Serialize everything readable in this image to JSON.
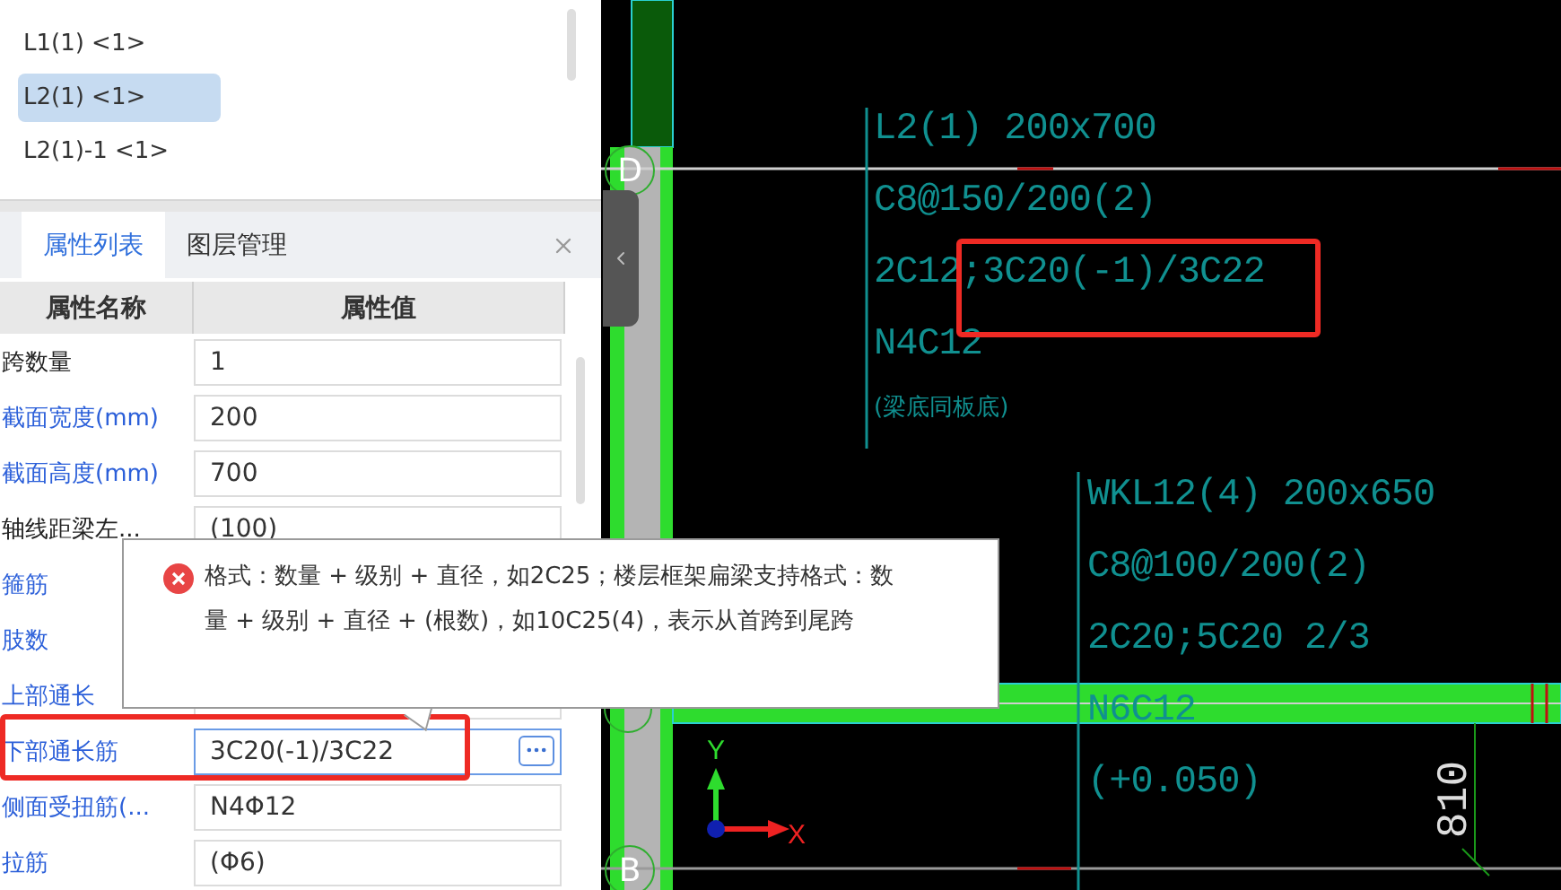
{
  "tree": {
    "items": [
      {
        "label": "L1(1) <1>",
        "selected": false
      },
      {
        "label": "L2(1) <1>",
        "selected": true
      },
      {
        "label": "L2(1)-1 <1>",
        "selected": false
      }
    ]
  },
  "tabs": [
    {
      "label": "属性列表",
      "selected": true
    },
    {
      "label": "图层管理",
      "selected": false
    }
  ],
  "table": {
    "columns": [
      "属性名称",
      "属性值"
    ],
    "rows": [
      {
        "name": "跨数量",
        "kind": "private",
        "value": "1",
        "focused": false
      },
      {
        "name": "截面宽度(mm)",
        "kind": "common",
        "value": "200",
        "focused": false
      },
      {
        "name": "截面高度(mm)",
        "kind": "common",
        "value": "700",
        "focused": false
      },
      {
        "name": "轴线距梁左...",
        "kind": "private",
        "value": "(100)",
        "focused": false
      },
      {
        "name": "箍筋",
        "kind": "common"
      },
      {
        "name": "肢数",
        "kind": "common"
      },
      {
        "name": "上部通长",
        "kind": "common"
      },
      {
        "name": "下部通长筋",
        "kind": "common",
        "value": "3C20(-1)/3C22",
        "focused": true
      },
      {
        "name": "侧面受扭筋(...",
        "kind": "common",
        "value": "N4Φ12",
        "focused": false
      },
      {
        "name": "拉筋",
        "kind": "common",
        "value": "(Φ6)",
        "focused": false
      }
    ]
  },
  "tooltip": {
    "message": "格式：数量 + 级别 + 直径，如2C25；楼层框架扁梁支持格式：数量 + 级别 + 直径 + (根数)，如10C25(4)，表示从首跨到尾跨"
  },
  "drawing": {
    "axes": [
      "D",
      "B"
    ],
    "beams": [
      {
        "lines": [
          "L2(1) 200x700",
          "C8@150/200(2)",
          "2C12;3C20(-1)/3C22",
          "N4C12"
        ],
        "note": "(梁底同板底)"
      },
      {
        "lines": [
          "WKL12(4) 200x650",
          "C8@100/200(2)",
          "2C20;5C20 2/3",
          "N6C12",
          "(+0.050)"
        ]
      }
    ],
    "dimension": "810",
    "axis_x": "X",
    "axis_y": "Y"
  }
}
